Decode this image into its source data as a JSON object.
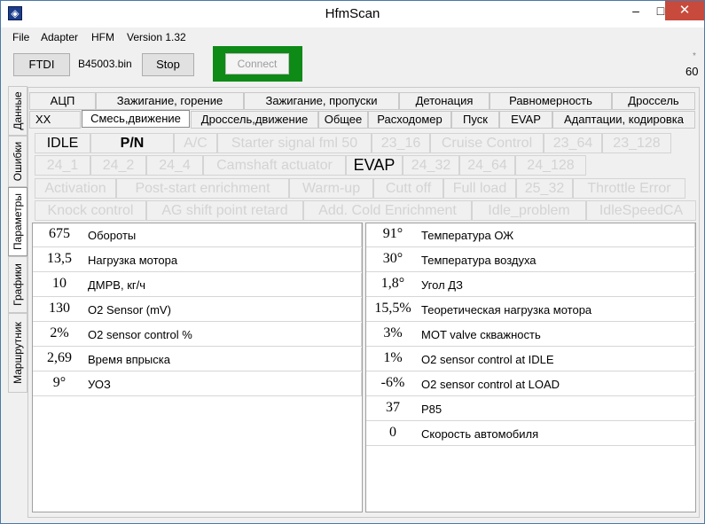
{
  "window": {
    "title": "HfmScan",
    "min_glyph": "–",
    "max_glyph": "□",
    "close_glyph": "✕"
  },
  "menu": [
    "File",
    "Adapter",
    "HFM",
    "Version 1.32"
  ],
  "toolbar": {
    "ftdi_label": "FTDI",
    "file_name": "B45003.bin",
    "stop_label": "Stop",
    "connect_label": "Connect",
    "counter_star": "*",
    "counter_value": "60"
  },
  "side_tabs": [
    "Данные",
    "Ошибки",
    "Параметры",
    "Графики",
    "Маршрутник"
  ],
  "tabs_row1": [
    "АЦП",
    "Зажигание, горение",
    "Зажигание, пропуски",
    "Детонация",
    "Равномерность",
    "Дроссель"
  ],
  "tabs_row2": [
    "ХХ",
    "Смесь,движение",
    "Дроссель,движение",
    "Общее",
    "Расходомер",
    "Пуск",
    "EVAP",
    "Адаптации, кодировка"
  ],
  "flags": [
    [
      "IDLE",
      "P/N",
      "A/C",
      "Starter signal fml 50",
      "23_16",
      "Cruise Control",
      "23_64",
      "23_128"
    ],
    [
      "24_1",
      "24_2",
      "24_4",
      "Camshaft actuator",
      "EVAP",
      "24_32",
      "24_64",
      "24_128"
    ],
    [
      "Activation",
      "Post-start enrichment",
      "Warm-up",
      "Cutt off",
      "Full load",
      "25_32",
      "Throttle Error"
    ],
    [
      "Knock control",
      "AG shift point retard",
      "Add. Cold Enrichment",
      "Idle_problem",
      "IdleSpeedCA"
    ]
  ],
  "active_flags": [
    "IDLE",
    "P/N",
    "EVAP"
  ],
  "left_params": [
    {
      "value": "675",
      "label": "Обороты"
    },
    {
      "value": "13,5",
      "label": "Нагрузка мотора"
    },
    {
      "value": "10",
      "label": "ДМРВ, кг/ч"
    },
    {
      "value": "130",
      "label": "O2 Sensor (mV)"
    },
    {
      "value": "2%",
      "label": "O2 sensor control %"
    },
    {
      "value": "2,69",
      "label": "Время впрыска"
    },
    {
      "value": "9°",
      "label": "УОЗ"
    }
  ],
  "right_params": [
    {
      "value": "91°",
      "label": "Температура ОЖ"
    },
    {
      "value": "30°",
      "label": "Температура воздуха"
    },
    {
      "value": "1,8°",
      "label": "Угол ДЗ"
    },
    {
      "value": "15,5%",
      "label": "Теоретическая нагрузка мотора"
    },
    {
      "value": "3%",
      "label": "MOT valve скважность"
    },
    {
      "value": "1%",
      "label": "O2 sensor control at IDLE"
    },
    {
      "value": "-6%",
      "label": "O2 sensor control at LOAD"
    },
    {
      "value": "37",
      "label": "P85"
    },
    {
      "value": "0",
      "label": "Скорость автомобиля"
    }
  ],
  "colors": {
    "connect_frame": "#0e8a16",
    "close_button": "#c74a3c",
    "inactive_flag_text": "#d3d3d3"
  }
}
